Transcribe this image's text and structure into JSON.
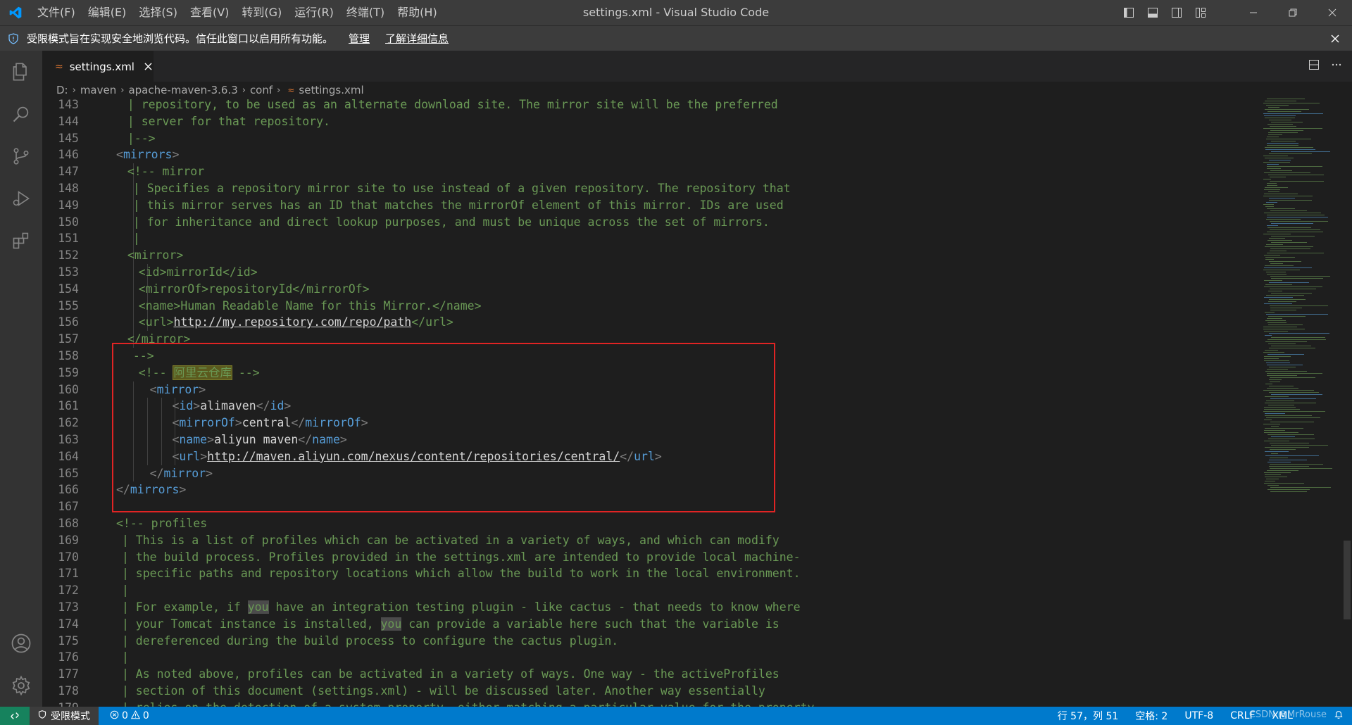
{
  "window": {
    "title": "settings.xml - Visual Studio Code",
    "menu": [
      "文件(F)",
      "编辑(E)",
      "选择(S)",
      "查看(V)",
      "转到(G)",
      "运行(R)",
      "终端(T)",
      "帮助(H)"
    ]
  },
  "banner": {
    "text": "受限模式旨在实现安全地浏览代码。信任此窗口以启用所有功能。",
    "manage": "管理",
    "learn_more": "了解详细信息"
  },
  "tab": {
    "label": "settings.xml"
  },
  "breadcrumbs": [
    "D:",
    "maven",
    "apache-maven-3.6.3",
    "conf",
    "settings.xml"
  ],
  "editor": {
    "lines": [
      {
        "n": "143",
        "text": "| repository, to be used as an alternate download site. The mirror site will be the preferred"
      },
      {
        "n": "144",
        "text": "| server for that repository."
      },
      {
        "n": "145",
        "text": "|-->"
      },
      {
        "n": "146",
        "text": "<mirrors>"
      },
      {
        "n": "147",
        "text": "<!-- mirror"
      },
      {
        "n": "148",
        "text": "| Specifies a repository mirror site to use instead of a given repository. The repository that"
      },
      {
        "n": "149",
        "text": "| this mirror serves has an ID that matches the mirrorOf element of this mirror. IDs are used"
      },
      {
        "n": "150",
        "text": "| for inheritance and direct lookup purposes, and must be unique across the set of mirrors."
      },
      {
        "n": "151",
        "text": "|"
      },
      {
        "n": "152",
        "text": "<mirror>"
      },
      {
        "n": "153",
        "text": "<id>mirrorId</id>"
      },
      {
        "n": "154",
        "text": "<mirrorOf>repositoryId</mirrorOf>"
      },
      {
        "n": "155",
        "text": "<name>Human Readable Name for this Mirror.</name>"
      },
      {
        "n": "156",
        "text": "<url>http://my.repository.com/repo/path</url>"
      },
      {
        "n": "157",
        "text": "</mirror>"
      },
      {
        "n": "158",
        "text": "-->"
      },
      {
        "n": "159",
        "text": "<!-- 阿里云仓库 -->"
      },
      {
        "n": "160",
        "text": "<mirror>"
      },
      {
        "n": "161",
        "text": "<id>alimaven</id>"
      },
      {
        "n": "162",
        "text": "<mirrorOf>central</mirrorOf>"
      },
      {
        "n": "163",
        "text": "<name>aliyun maven</name>"
      },
      {
        "n": "164",
        "text": "<url>http://maven.aliyun.com/nexus/content/repositories/central/</url>"
      },
      {
        "n": "165",
        "text": "</mirror>"
      },
      {
        "n": "166",
        "text": "</mirrors>"
      },
      {
        "n": "167",
        "text": ""
      },
      {
        "n": "168",
        "text": "<!-- profiles"
      },
      {
        "n": "169",
        "text": "| This is a list of profiles which can be activated in a variety of ways, and which can modify"
      },
      {
        "n": "170",
        "text": "| the build process. Profiles provided in the settings.xml are intended to provide local machine-"
      },
      {
        "n": "171",
        "text": "| specific paths and repository locations which allow the build to work in the local environment."
      },
      {
        "n": "172",
        "text": "|"
      },
      {
        "n": "173",
        "text": "| For example, if you have an integration testing plugin - like cactus - that needs to know where"
      },
      {
        "n": "174",
        "text": "| your Tomcat instance is installed, you can provide a variable here such that the variable is"
      },
      {
        "n": "175",
        "text": "| dereferenced during the build process to configure the cactus plugin."
      },
      {
        "n": "176",
        "text": "|"
      },
      {
        "n": "177",
        "text": "| As noted above, profiles can be activated in a variety of ways. One way - the activeProfiles"
      },
      {
        "n": "178",
        "text": "| section of this document (settings.xml) - will be discussed later. Another way essentially"
      },
      {
        "n": "179",
        "text": "| relies on the detection of a system property, either matching a particular value for the property,"
      }
    ]
  },
  "statusbar": {
    "restricted": "受限模式",
    "errors": "0",
    "warnings": "0",
    "position": "行 57，列 51",
    "indent": "空格: 2",
    "encoding": "UTF-8",
    "eol": "CRLF",
    "language": "XML",
    "watermark": "CSDN @MrRouse"
  },
  "colors": {
    "accent": "#007acc",
    "highlight_box": "#e02424",
    "comment": "#6a9955",
    "tag": "#569cd6"
  }
}
